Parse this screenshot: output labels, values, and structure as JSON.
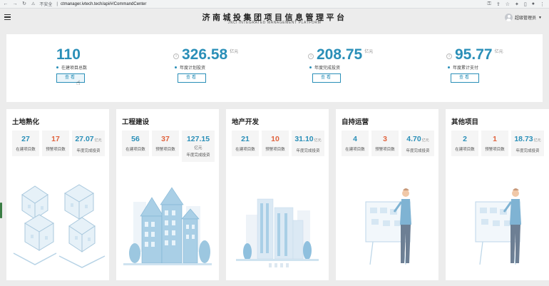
{
  "browser": {
    "security": "不安全",
    "url": "ctmanager.ivtech.tech/api/#/CommandCenter"
  },
  "header": {
    "title": "济南城投集团项目信息管理平台",
    "subtitle": "JNCI INTEGRATED MANAGEMENT PLATFORM",
    "user": "超级管理员"
  },
  "summary": [
    {
      "value": "110",
      "unit": "",
      "label": "在建项目总数",
      "button": "查看"
    },
    {
      "value": "326.58",
      "unit": "亿元",
      "label": "年度计划投资",
      "button": "查看"
    },
    {
      "value": "208.75",
      "unit": "亿元",
      "label": "年度完成投资",
      "button": "查看"
    },
    {
      "value": "95.77",
      "unit": "亿元",
      "label": "年度累计支付",
      "button": "查看"
    }
  ],
  "cards": [
    {
      "title": "土地熟化",
      "m1": {
        "value": "27",
        "label": "在建项目数"
      },
      "m2": {
        "value": "17",
        "label": "预警项目数"
      },
      "m3": {
        "value": "27.07",
        "unit": "亿元",
        "label": "年度完成投资"
      }
    },
    {
      "title": "工程建设",
      "m1": {
        "value": "56",
        "label": "在建项目数"
      },
      "m2": {
        "value": "37",
        "label": "预警项目数"
      },
      "m3": {
        "value": "127.15",
        "unit": "亿元",
        "label": "年度完成投资"
      }
    },
    {
      "title": "地产开发",
      "m1": {
        "value": "21",
        "label": "在建项目数"
      },
      "m2": {
        "value": "10",
        "label": "预警项目数"
      },
      "m3": {
        "value": "31.10",
        "unit": "亿元",
        "label": "年度完成投资"
      }
    },
    {
      "title": "自持运营",
      "m1": {
        "value": "4",
        "label": "在建项目数"
      },
      "m2": {
        "value": "3",
        "label": "预警项目数"
      },
      "m3": {
        "value": "4.70",
        "unit": "亿元",
        "label": "年度完成投资"
      }
    },
    {
      "title": "其他项目",
      "m1": {
        "value": "2",
        "label": "在建项目数"
      },
      "m2": {
        "value": "1",
        "label": "预警项目数"
      },
      "m3": {
        "value": "18.73",
        "unit": "亿元",
        "label": "年度完成投资"
      }
    }
  ],
  "colors": {
    "accent": "#2a8fb8",
    "warning": "#e0623d",
    "background": "#ececec"
  }
}
